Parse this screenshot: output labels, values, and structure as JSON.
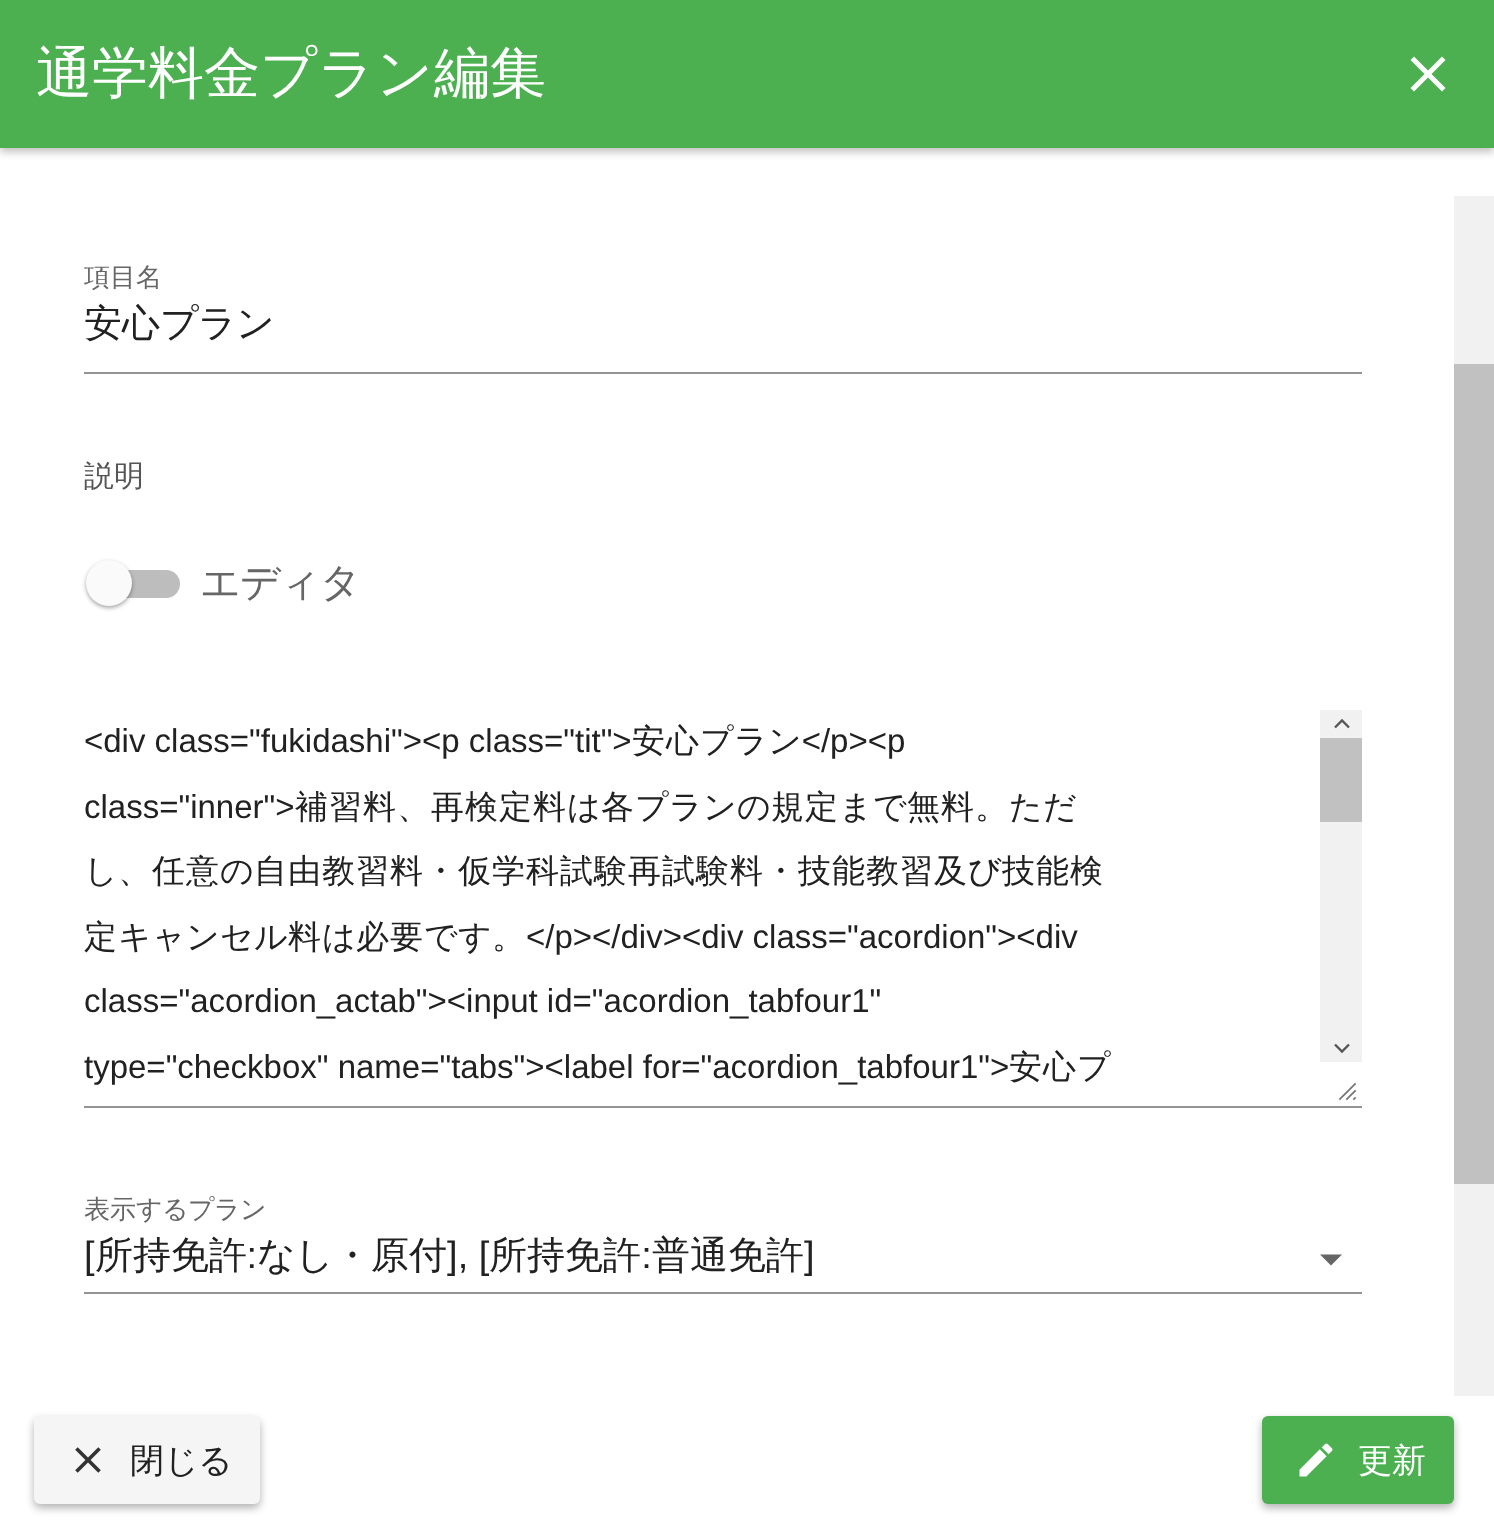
{
  "dialog": {
    "title": "通学料金プラン編集"
  },
  "name_field": {
    "label": "項目名",
    "value": "安心プラン"
  },
  "description": {
    "label": "説明",
    "editor_toggle": {
      "label": "エディタ",
      "on": false
    },
    "source_lines": [
      "<div class=\"fukidashi\"><p class=\"tit\">安心プラン</p><p",
      "class=\"inner\">補習料、再検定料は各プランの規定まで無料。ただ",
      "し、任意の自由教習料・仮学科試験再試験料・技能教習及び技能検",
      "定キャンセル料は必要です。</p></div><div class=\"acordion\"><div",
      "class=\"acordion_actab\"><input id=\"acordion_tabfour1\"",
      "type=\"checkbox\" name=\"tabs\"><label for=\"acordion_tabfour1\">安心プ"
    ]
  },
  "plan_select": {
    "label": "表示するプラン",
    "value": "[所持免許:なし・原付], [所持免許:普通免許]"
  },
  "buttons": [
    {
      "kind": "close",
      "label": "閉じる"
    },
    {
      "kind": "update",
      "label": "更新"
    }
  ]
}
